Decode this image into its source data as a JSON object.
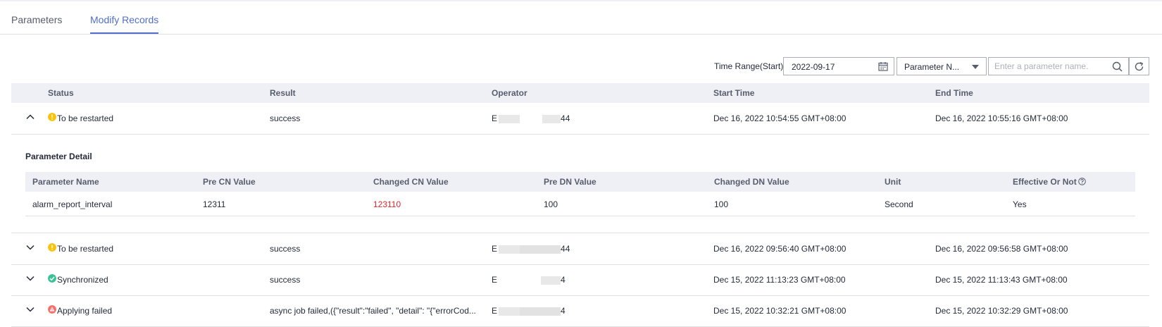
{
  "tabs": [
    {
      "label": "Parameters"
    },
    {
      "label": "Modify Records"
    }
  ],
  "toolbar": {
    "time_range_label": "Time Range(Start)",
    "date_value": "2022-09-17",
    "filter_select_value": "Parameter N...",
    "search_placeholder": "Enter a parameter name."
  },
  "table": {
    "headers": [
      "Status",
      "Result",
      "Operator",
      "Start Time",
      "End Time"
    ],
    "rows": [
      {
        "status": "To be restarted",
        "status_color": "#fac20a",
        "result": "success",
        "operator_prefix": "E",
        "operator_suffix": "44",
        "start": "Dec 16, 2022 10:54:55 GMT+08:00",
        "end": "Dec 16, 2022 10:55:16 GMT+08:00",
        "expanded": true
      },
      {
        "status": "To be restarted",
        "status_color": "#fac20a",
        "result": "success",
        "operator_prefix": "E",
        "operator_suffix": "44",
        "start": "Dec 16, 2022 09:56:40 GMT+08:00",
        "end": "Dec 16, 2022 09:56:58 GMT+08:00",
        "expanded": false
      },
      {
        "status": "Synchronized",
        "status_color": "#3ac295",
        "result": "success",
        "operator_prefix": "E",
        "operator_suffix": "4",
        "start": "Dec 15, 2022 11:13:23 GMT+08:00",
        "end": "Dec 15, 2022 11:13:43 GMT+08:00",
        "expanded": false
      },
      {
        "status": "Applying failed",
        "status_color": "#f66f6a",
        "result": "async job failed,({\"result\":\"failed\", \"detail\": \"{\"errorCod...",
        "operator_prefix": "E",
        "operator_suffix": "4",
        "start": "Dec 15, 2022 10:32:21 GMT+08:00",
        "end": "Dec 15, 2022 10:32:29 GMT+08:00",
        "expanded": false
      }
    ]
  },
  "detail": {
    "title": "Parameter Detail",
    "headers": [
      "Parameter Name",
      "Pre CN Value",
      "Changed CN Value",
      "Pre DN Value",
      "Changed DN Value",
      "Unit",
      "Effective Or Not"
    ],
    "row": {
      "name": "alarm_report_interval",
      "pre_cn": "12311",
      "changed_cn": "123110",
      "changed_cn_color": "#e5242b",
      "pre_dn": "100",
      "changed_dn": "100",
      "unit": "Second",
      "effective": "Yes"
    }
  },
  "colors": {
    "accent": "#526ecc",
    "warning": "#fac20a",
    "success": "#3ac295",
    "error": "#f66f6a",
    "changed_value": "#e5242b"
  }
}
